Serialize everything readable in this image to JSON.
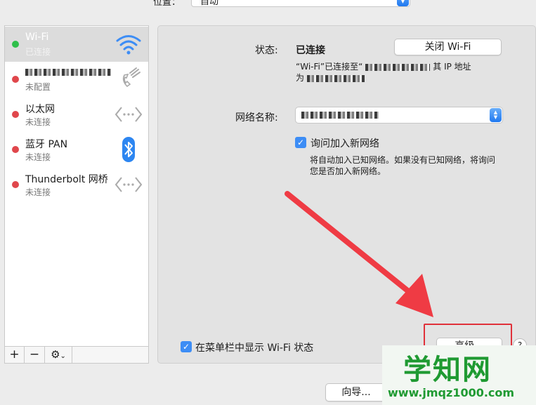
{
  "window": {
    "location_label": "位置：",
    "location_value": "自动"
  },
  "sidebar": {
    "items": [
      {
        "name": "Wi-Fi",
        "status": "已连接",
        "dot_color": "#2fbf4a",
        "icon": "wifi-icon"
      },
      {
        "name": "",
        "status": "未配置",
        "dot_color": "#e0474c",
        "icon": "phone-icon"
      },
      {
        "name": "以太网",
        "status": "未连接",
        "dot_color": "#e0474c",
        "icon": "ethernet-icon"
      },
      {
        "name": "蓝牙 PAN",
        "status": "未连接",
        "dot_color": "#e0474c",
        "icon": "bluetooth-icon"
      },
      {
        "name": "Thunderbolt 网桥",
        "status": "未连接",
        "dot_color": "#e0474c",
        "icon": "thunderbolt-bridge-icon"
      }
    ],
    "tools": {
      "add": "+",
      "remove": "−",
      "gear": "⚙"
    }
  },
  "main": {
    "status_label": "状态:",
    "status_value": "已连接",
    "turn_off_button": "关闭 Wi-Fi",
    "status_detail_1a": "“Wi-Fi”已连接至“",
    "status_detail_1b": "其 IP 地址",
    "status_detail_2": "为",
    "network_name_label": "网络名称:",
    "ask_join_label": "询问加入新网络",
    "ask_join_checked": true,
    "ask_join_desc_1": "将自动加入已知网络。如果没有已知网络，将询问",
    "ask_join_desc_2": "您是否加入新网络。",
    "show_in_menubar_label": "在菜单栏中显示 Wi-Fi 状态",
    "show_in_menubar_checked": true,
    "advanced_button": "高级...",
    "help_button": "?"
  },
  "footer": {
    "assist_button": "向导..."
  },
  "watermark": {
    "title": "学知网",
    "url": "www.jmqz1000.com"
  },
  "colors": {
    "accent_blue": "#3d8df5",
    "highlight_red": "#e0313a",
    "connected_green": "#2fbf4a",
    "disconnected_red": "#e0474c"
  }
}
